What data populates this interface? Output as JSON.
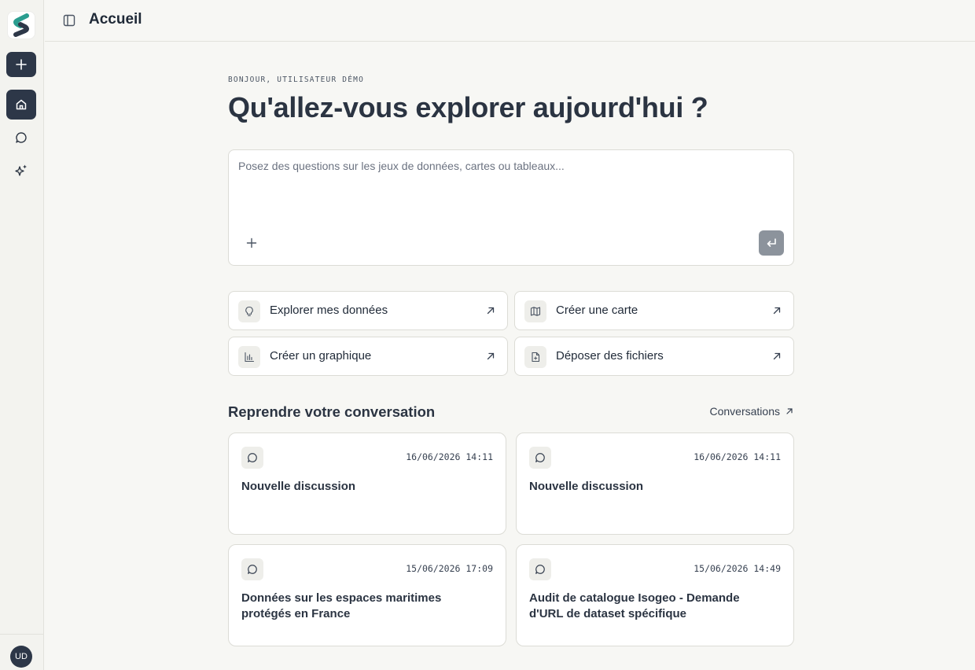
{
  "sidebar": {
    "logo_letter": "S",
    "avatar_initials": "UD",
    "items": [
      {
        "icon": "plus-icon"
      },
      {
        "icon": "home-icon"
      },
      {
        "icon": "chat-bubble-icon"
      },
      {
        "icon": "sparkles-icon"
      }
    ]
  },
  "header": {
    "title": "Accueil"
  },
  "main": {
    "greeting": "BONJOUR, UTILISATEUR DÉMO",
    "headline": "Qu'allez-vous explorer aujourd'hui ?",
    "composer": {
      "placeholder": "Posez des questions sur les jeux de données, cartes ou tableaux...",
      "value": ""
    },
    "actions": [
      {
        "label": "Explorer mes données",
        "icon": "lightbulb-icon"
      },
      {
        "label": "Créer une carte",
        "icon": "map-icon"
      },
      {
        "label": "Créer un graphique",
        "icon": "bar-chart-icon"
      },
      {
        "label": "Déposer des fichiers",
        "icon": "file-upload-icon"
      }
    ],
    "section_title": "Reprendre votre conversation",
    "conversations_link": "Conversations",
    "conversations": [
      {
        "date": "16/06/2026 14:11",
        "title": "Nouvelle discussion"
      },
      {
        "date": "16/06/2026 14:11",
        "title": "Nouvelle discussion"
      },
      {
        "date": "15/06/2026 17:09",
        "title": "Données sur les espaces maritimes protégés en France"
      },
      {
        "date": "15/06/2026 14:49",
        "title": "Audit de catalogue Isogeo - Demande d'URL de dataset spécifique"
      }
    ]
  },
  "colors": {
    "accent": "#2d3748",
    "background": "#f7f7f4",
    "send_button": "#8c939c",
    "logo_teal": "#2a9d8f",
    "logo_navy": "#2d3748"
  }
}
